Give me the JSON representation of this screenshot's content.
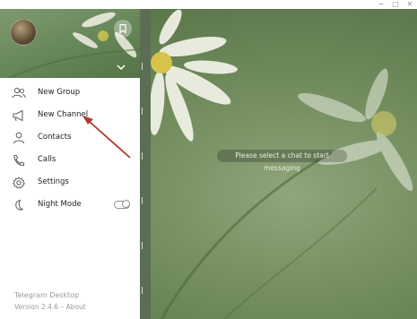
{
  "window": {
    "controls": [
      "−",
      "□",
      "✕"
    ]
  },
  "chat": {
    "empty_message": "Please select a chat to start messaging"
  },
  "menu": {
    "items": [
      {
        "label": "New Group",
        "icon": "group-icon"
      },
      {
        "label": "New Channel",
        "icon": "megaphone-icon"
      },
      {
        "label": "Contacts",
        "icon": "person-icon"
      },
      {
        "label": "Calls",
        "icon": "phone-icon"
      },
      {
        "label": "Settings",
        "icon": "gear-icon"
      },
      {
        "label": "Night Mode",
        "icon": "moon-icon"
      }
    ],
    "night_mode_on": false
  },
  "footer": {
    "app_name": "Telegram Desktop",
    "version": "Version 2.4.6 – About"
  },
  "colors": {
    "annotation_arrow": "#b23a2a",
    "menu_text": "#222222",
    "footer_text": "#9a9a9a"
  }
}
